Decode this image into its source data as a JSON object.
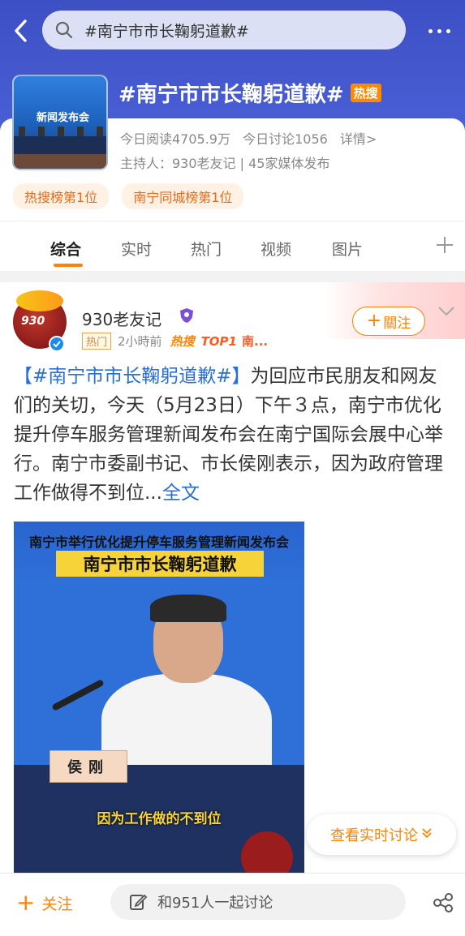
{
  "search": {
    "query": "#南宁市市长鞠躬道歉#"
  },
  "topic": {
    "thumbnail_text": "新闻发布会",
    "title": "#南宁市市长鞠躬道歉#",
    "hot_badge": "热搜",
    "stats_read": "今日阅读4705.9万",
    "stats_discuss": "今日讨论1056",
    "details_link": "详情>",
    "host_line": "主持人：930老友记 | 45家媒体发布",
    "rank_tags": [
      "热搜榜第1位",
      "南宁同城榜第1位"
    ]
  },
  "tabs": [
    "综合",
    "实时",
    "热门",
    "视频",
    "图片"
  ],
  "active_tab": "综合",
  "post": {
    "avatar_text": "930",
    "author": "930老友记",
    "meta": {
      "hot_tag": "热门",
      "time": "2小時前",
      "resou": "热搜",
      "top": "TOP1",
      "trunc": "南..."
    },
    "follow_label": "關注",
    "text_hashtag": "【#南宁市市长鞠躬道歉#】",
    "text_body": "为回应市民朋友和网友们的关切，今天（5月23日）下午３点，南宁市优化提升停车服务管理新闻发布会在南宁国际会展中心举行。南宁市委副书记、市长侯刚表示，因为政府管理工作做得不到位...",
    "text_more": "全文",
    "video": {
      "subtitle": "南宁市举行优化提升停车服务管理新闻发布会",
      "title": "南宁市市长鞠躬道歉",
      "nameplate": "侯刚",
      "caption": "因为工作做的不到位"
    }
  },
  "realtime_button": "查看实时讨论",
  "bottom": {
    "follow_label": "关注",
    "discuss_placeholder": "和951人一起讨论"
  },
  "colors": {
    "accent": "#ff8200",
    "link": "#2a6fd6",
    "header": "#4a5fd6"
  }
}
